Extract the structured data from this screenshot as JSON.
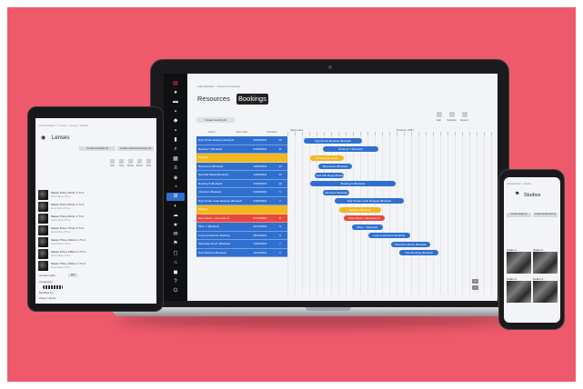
{
  "laptop": {
    "breadcrumb": "Administration > Resource booking",
    "tabs": [
      {
        "label": "Resources",
        "active": false
      },
      {
        "label": "Bookings",
        "active": true
      }
    ],
    "create_button": "Create booking ⊕",
    "tools": [
      "Edit",
      "Settings",
      "Export"
    ],
    "columns": [
      "Name",
      "Start date",
      "Duration"
    ],
    "months": [
      "September",
      "October, 2021"
    ],
    "rows": [
      {
        "name": "Digi Terrain Booking Example",
        "date": "06/09/2021",
        "dur": "10",
        "color": "#2f6fd0"
      },
      {
        "name": "Booking 7 (Booked)",
        "date": "01/08/2021",
        "dur": "11",
        "color": "#2f6fd0"
      },
      {
        "name": "Pending",
        "date": "",
        "dur": "",
        "color": "#f2b71f"
      },
      {
        "name": "Resources (Booked)",
        "date": "10/09/2021",
        "dur": "13",
        "color": "#2f6fd0"
      },
      {
        "name": "Red Flat Mega (Booked)",
        "date": "14/09/2021",
        "dur": "13",
        "color": "#2f6fd0"
      },
      {
        "name": "Booking 5 (Booked)",
        "date": "01/09/2021",
        "dur": "13",
        "color": "#2f6fd0"
      },
      {
        "name": "Interview (Booked)",
        "date": "01/09/2021",
        "dur": "6",
        "color": "#2f6fd0"
      },
      {
        "name": "Digi Terrain Code Request (Booked)",
        "date": "04/09/2021",
        "dur": "7",
        "color": "#2f6fd0"
      },
      {
        "name": "Pending",
        "date": "",
        "dur": "",
        "color": "#f2b71f"
      },
      {
        "name": "Zone Mixer + Mercedes 6",
        "date": "07/10/2021",
        "dur": "8",
        "color": "#e8493f"
      },
      {
        "name": "Mixer 7 (Booked)",
        "date": "01/10/2021",
        "dur": "5",
        "color": "#2f6fd0"
      },
      {
        "name": "Loop Conference Booking",
        "date": "08/10/2021",
        "dur": "9",
        "color": "#2f6fd0"
      },
      {
        "name": "Mercedes Rover (Booked)",
        "date": "14/10/2021",
        "dur": "7",
        "color": "#2f6fd0"
      },
      {
        "name": "New Booking (Booked)",
        "date": "16/10/2021",
        "dur": "6",
        "color": "#2f6fd0"
      }
    ],
    "bars": [
      {
        "label": "Digi Terrain Booking (Booked)",
        "start": 0.08,
        "end": 0.36,
        "row": 0,
        "color": "#2f6fd0"
      },
      {
        "label": "Booking 7 (Booked)",
        "start": 0.17,
        "end": 0.44,
        "row": 1,
        "color": "#2f6fd0"
      },
      {
        "label": "Pending (Booked)",
        "start": 0.11,
        "end": 0.27,
        "row": 2,
        "color": "#f2b71f"
      },
      {
        "label": "Resources (Booked)",
        "start": 0.15,
        "end": 0.31,
        "row": 3,
        "color": "#2f6fd0"
      },
      {
        "label": "Red Flat Mega (Booked)",
        "start": 0.13,
        "end": 0.27,
        "row": 4,
        "color": "#2f6fd0"
      },
      {
        "label": "Booking 5 (Booked)",
        "start": 0.11,
        "end": 0.52,
        "row": 5,
        "color": "#2f6fd0"
      },
      {
        "label": "Interview (Booked)",
        "start": 0.17,
        "end": 0.3,
        "row": 6,
        "color": "#2f6fd0"
      },
      {
        "label": "Digi Terrain Code Request (Booked)",
        "start": 0.23,
        "end": 0.56,
        "row": 7,
        "color": "#2f6fd0"
      },
      {
        "label": "Pending (Booked)",
        "start": 0.25,
        "end": 0.45,
        "row": 8,
        "color": "#f2b71f"
      },
      {
        "label": "Zone Mixer + Mercedes 6",
        "start": 0.27,
        "end": 0.47,
        "row": 9,
        "color": "#e8493f"
      },
      {
        "label": "Mixer 7 (Booked)",
        "start": 0.31,
        "end": 0.46,
        "row": 10,
        "color": "#2f6fd0"
      },
      {
        "label": "Loop Conference Booking",
        "start": 0.39,
        "end": 0.59,
        "row": 11,
        "color": "#2f6fd0"
      },
      {
        "label": "Mercedes Rover (Booked)",
        "start": 0.5,
        "end": 0.69,
        "row": 12,
        "color": "#2f6fd0"
      },
      {
        "label": "New Booking (Booked)",
        "start": 0.54,
        "end": 0.73,
        "row": 13,
        "color": "#2f6fd0"
      }
    ],
    "sidebar_icons": [
      "logo-icon",
      "user-icon",
      "film-icon",
      "image-icon",
      "cog-icon",
      "folder-icon",
      "chart-icon",
      "search-icon",
      "grid-icon",
      "list-icon",
      "tag-icon",
      "bell-icon",
      "bookings-icon",
      "drop-icon",
      "cloud-icon",
      "star-icon",
      "mail-icon",
      "flag-icon",
      "chat-icon",
      "home-icon",
      "lock-icon",
      "help-icon",
      "logout-icon"
    ]
  },
  "tablet": {
    "breadcrumb": "Administration > Lenses > Lenses > Details",
    "title": "Lenses",
    "buttons": [
      "Create lens/filter ⊕",
      "Create optical accessory ⊕"
    ],
    "tools": [
      "Edit",
      "Copy",
      "Delete",
      "Export",
      "Print"
    ],
    "items": [
      {
        "name": "Master Prime 40mm 1 T1.3",
        "sub": "Zeiss Master Prime"
      },
      {
        "name": "Master Prime 50mm 1 T1.3",
        "sub": "Zeiss Master Prime"
      },
      {
        "name": "Master Prime 65mm 1 T1.3",
        "sub": "Zeiss Master Prime"
      },
      {
        "name": "Master Prime 75mm 1 T1.3",
        "sub": "Zeiss Master Prime"
      },
      {
        "name": "Master Prime 100mm 1 T1.3",
        "sub": "Zeiss Master Prime"
      },
      {
        "name": "Master Prime 135mm 1 T1.3",
        "sub": "Zeiss Master Prime"
      },
      {
        "name": "Master Prime 150mm 1 T1.3",
        "sub": "Zeiss Master Prime"
      }
    ],
    "section_label": "Access rights",
    "section_button": "Edit",
    "info_lines": [
      "Created by",
      "Modified by",
      "Owner: Admin"
    ]
  },
  "phone": {
    "breadcrumb": "Administration > Studios",
    "title": "Studios",
    "buttons": [
      "Create studio ⊕",
      "Create studio item ⊕"
    ],
    "cards": [
      "Studio 1",
      "Studio 2",
      "Studio 3",
      "Studio 4"
    ]
  }
}
